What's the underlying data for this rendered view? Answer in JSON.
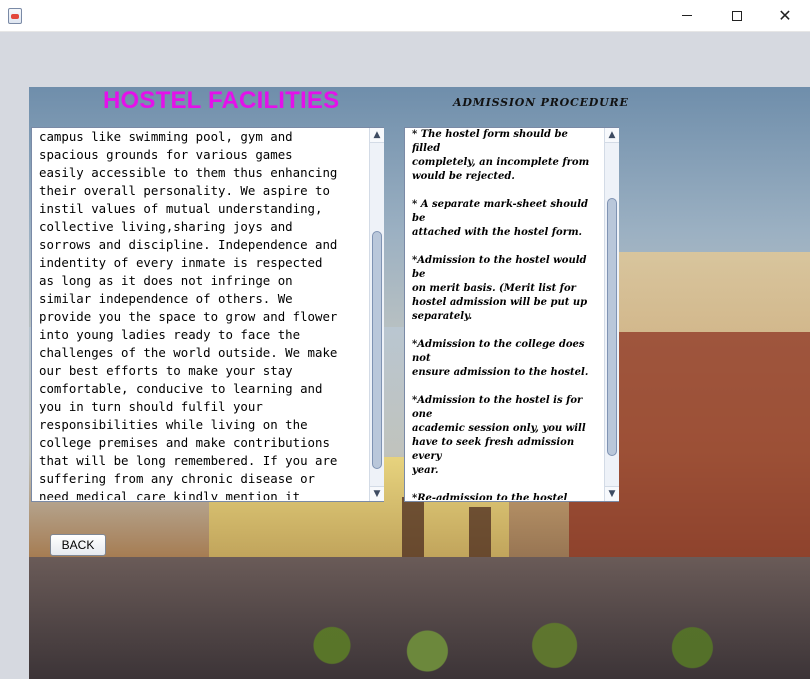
{
  "window": {
    "title": "",
    "controls": {
      "minimize_icon": "minimize-icon",
      "maximize_icon": "maximize-icon",
      "close_icon": "close-icon"
    }
  },
  "headings": {
    "hostel_facilities": "HOSTEL FACILITIES",
    "admission_procedure": "ADMISSION PROCEDURE"
  },
  "left_text": "campus like swimming pool, gym and\nspacious grounds for various games\neasily accessible to them thus enhancing\ntheir overall personality. We aspire to\ninstil values of mutual understanding,\ncollective living,sharing joys and\nsorrows and discipline. Independence and\nindentity of every inmate is respected\nas long as it does not infringe on\nsimilar independence of others. We\nprovide you the space to grow and flower\ninto young ladies ready to face the\nchallenges of the world outside. We make\nour best efforts to make your stay\ncomfortable, conducive to learning and\nyou in turn should fulfil your\nresponsibilities while living on the\ncollege premises and make contributions\nthat will be long remembered. If you are\nsuffering from any chronic disease or\nneed medical care kindly mention it",
  "right_text": "* The hostel form should be filled\ncompletely, an incomplete from\nwould be rejected.\n\n* A separate mark-sheet should be\nattached with the hostel form.\n\n*Admission to the hostel would be\non merit basis. (Merit list for\nhostel admission will be put up\nseparately.\n\n*Admission to the college does not\nensure admission to the hostel.\n\n*Admission to the hostel is for one\nacademic session only, you will\nhave to seek fresh admission every\nyear.\n\n*Re-admission to the hostel can't\nbe considered a matter of right and\nwill depend on whether you have\nobserved all the rules or not.\n\n*Students who fail in Part I & II\nare not entitled to re-admission in",
  "buttons": {
    "back": "BACK"
  },
  "icons": {
    "scroll_up": "arrow-up-icon",
    "scroll_down": "arrow-down-icon"
  }
}
